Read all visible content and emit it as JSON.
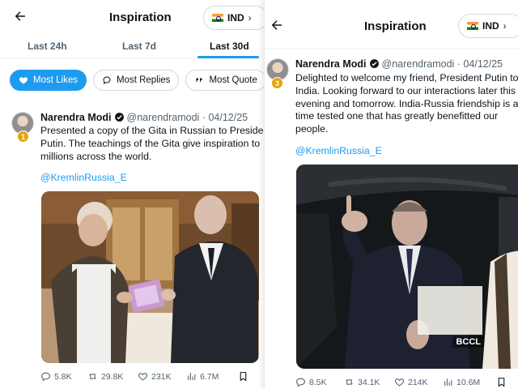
{
  "left": {
    "header": {
      "title": "Inspiration",
      "country": "IND"
    },
    "tabs": [
      {
        "label": "Last 24h",
        "active": false
      },
      {
        "label": "Last 7d",
        "active": false
      },
      {
        "label": "Last 30d",
        "active": true
      }
    ],
    "filters": [
      {
        "label": "Most Likes",
        "icon": "heart-icon",
        "active": true
      },
      {
        "label": "Most Replies",
        "icon": "reply-icon",
        "active": false
      },
      {
        "label": "Most Quote",
        "icon": "quote-icon",
        "active": false
      }
    ],
    "post": {
      "rank": "1",
      "name": "Narendra Modi",
      "handle": "@narendramodi",
      "date": "04/12/25",
      "text_lines": [
        "Presented a copy of the Gita in Russian to Presiden",
        "Putin. The teachings of the Gita give inspiration to",
        "millions across the world."
      ],
      "mention": "@KremlinRussia_E",
      "stats": {
        "replies": "5.8K",
        "reposts": "29.8K",
        "likes": "231K",
        "views": "6.7M"
      }
    }
  },
  "right": {
    "header": {
      "title": "Inspiration",
      "country": "IND"
    },
    "post": {
      "rank": "3",
      "name": "Narendra Modi",
      "handle": "@narendramodi",
      "date": "04/12/25",
      "text_lines": [
        "Delighted to welcome my friend, President Putin to",
        "India. Looking forward to our interactions later this",
        "evening and tomorrow. India-Russia friendship is a",
        "time tested one that has greatly benefitted our",
        "people."
      ],
      "mention": "@KremlinRussia_E",
      "media_watermark": "BCCL",
      "stats": {
        "replies": "8.5K",
        "reposts": "34.1K",
        "likes": "214K",
        "views": "10.6M"
      }
    }
  },
  "colors": {
    "accent": "#1d9bf0",
    "text": "#0f1419",
    "muted": "#536471",
    "rank_badge": "#e5a50a"
  }
}
